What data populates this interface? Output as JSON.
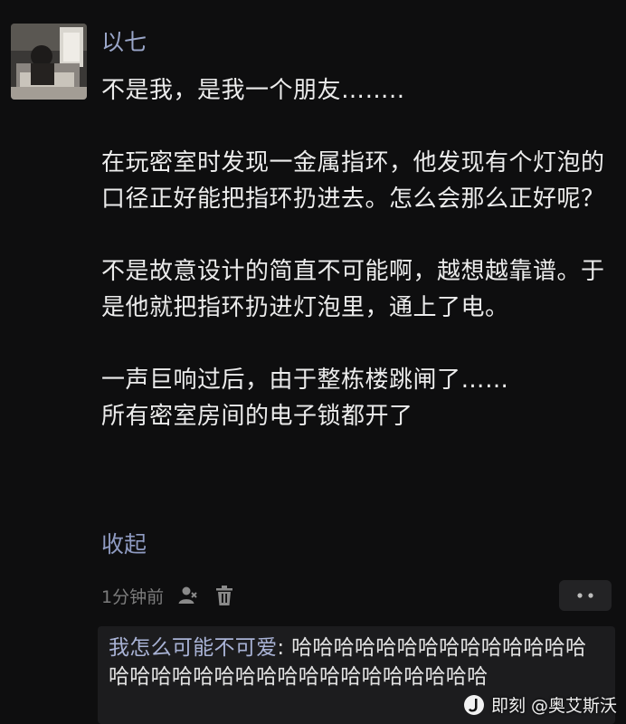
{
  "comment": {
    "author": "以七",
    "paragraphs": [
      "不是我，是我一个朋友……..",
      "在玩密室时发现一金属指环，他发现有个灯泡的口径正好能把指环扔进去。怎么会那么正好呢？",
      "不是故意设计的简直不可能啊，越想越靠谱。于是他就把指环扔进灯泡里，通上了电。",
      "一声巨响过后，由于整栋楼跳闸了……\n所有密室房间的电子锁都开了"
    ],
    "collapse_label": "收起",
    "timestamp": "1分钟前",
    "icons": {
      "user": "user-icon",
      "delete": "trash-icon",
      "more": "more-dots-icon"
    }
  },
  "reply": {
    "author": "我怎么可能不可爱",
    "separator": ": ",
    "text": "哈哈哈哈哈哈哈哈哈哈哈哈哈哈哈哈哈哈哈哈哈哈哈哈哈哈哈哈哈哈哈哈"
  },
  "watermark": {
    "logo_icon": "jike-logo-icon",
    "text": "即刻 @奥艾斯沃"
  }
}
